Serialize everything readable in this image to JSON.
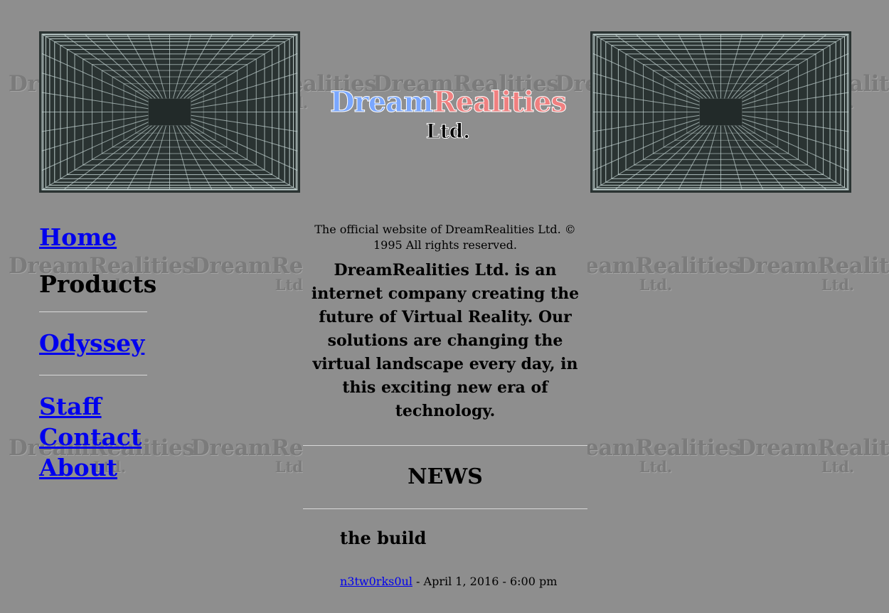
{
  "brand": {
    "name_part1": "Dream",
    "name_part2": "Realities",
    "suffix": "Ltd.",
    "watermark_name": "DreamRealities",
    "watermark_suffix": "Ltd.",
    "colors": {
      "dream": "#7aa7ff",
      "realities": "#f08080",
      "background": "#8e8e8e"
    }
  },
  "nav": {
    "home": "Home",
    "products": "Products",
    "odyssey": "Odyssey",
    "staff": "Staff",
    "contact": "Contact",
    "about": "About"
  },
  "main": {
    "copyright": "The official website of DreamRealities Ltd. © 1995 All rights reserved.",
    "mission": "DreamRealities Ltd. is an internet company creating the future of Virtual Reality. Our solutions are changing the virtual landscape every day, in this exciting new era of technology.",
    "news_heading": "NEWS"
  },
  "post": {
    "title": "the build",
    "author": "n3tw0rks0ul",
    "date": "- April 1, 2016 - 6:00 pm"
  },
  "icons": {
    "banner": "wireframe-tunnel-icon"
  }
}
